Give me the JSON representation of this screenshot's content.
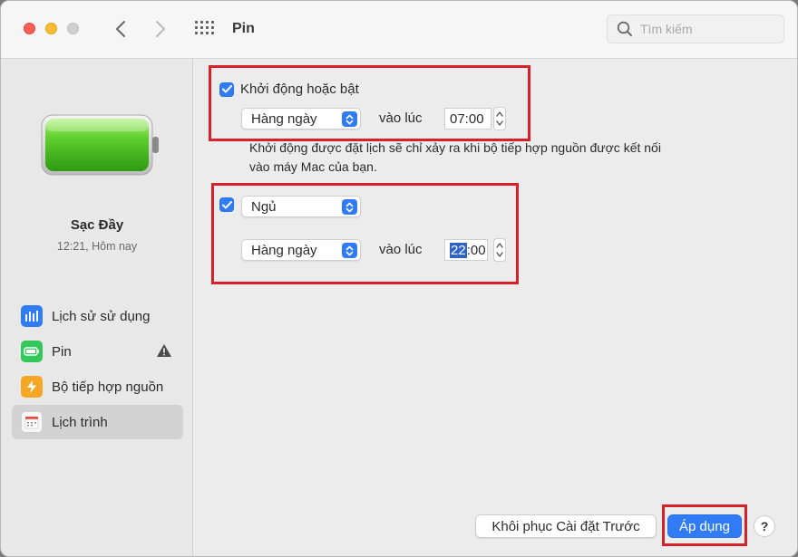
{
  "titlebar": {
    "title": "Pin",
    "search_placeholder": "Tìm kiếm"
  },
  "icons": {
    "back": "chevron-left-icon",
    "forward": "chevron-right-icon",
    "grid": "grid-icon",
    "search": "search-icon",
    "warning": "warning-icon",
    "battery": "battery-full-icon"
  },
  "sidebar": {
    "status_title": "Sạc Đầy",
    "status_time": "12:21, Hôm nay",
    "items": [
      {
        "label": "Lịch sử sử dụng",
        "icon": "bar-chart-icon",
        "color": "#2f7cf6"
      },
      {
        "label": "Pin",
        "icon": "battery-icon",
        "color": "#34c759"
      },
      {
        "label": "Bộ tiếp hợp nguồn",
        "icon": "bolt-icon",
        "color": "#f5a623"
      },
      {
        "label": "Lịch trình",
        "icon": "calendar-icon",
        "color": "#e5e5e5"
      }
    ]
  },
  "schedule": {
    "startup": {
      "checked": true,
      "label": "Khởi động hoặc bật",
      "frequency": "Hàng ngày",
      "at_label": "vào lúc",
      "time": "07:00"
    },
    "note": "Khởi động được đặt lịch sẽ chỉ xảy ra khi bộ tiếp hợp nguồn được kết nối vào máy Mac của bạn.",
    "note_line1": "Khởi động được đặt lịch sẽ chỉ xảy ra khi bộ tiếp hợp nguồn được kết nối",
    "note_line2": "vào máy Mac của bạn.",
    "sleep": {
      "checked": true,
      "action": "Ngủ",
      "frequency": "Hàng ngày",
      "at_label": "vào lúc",
      "time_hour": "22",
      "time_rest": ":00"
    }
  },
  "footer": {
    "restore_label": "Khôi phục Cài đặt Trước",
    "apply_label": "Áp dụng",
    "help_label": "?"
  },
  "colors": {
    "accent": "#2f7cf6",
    "annotation_red": "#d8202a",
    "battery_green": "#4cd137"
  }
}
